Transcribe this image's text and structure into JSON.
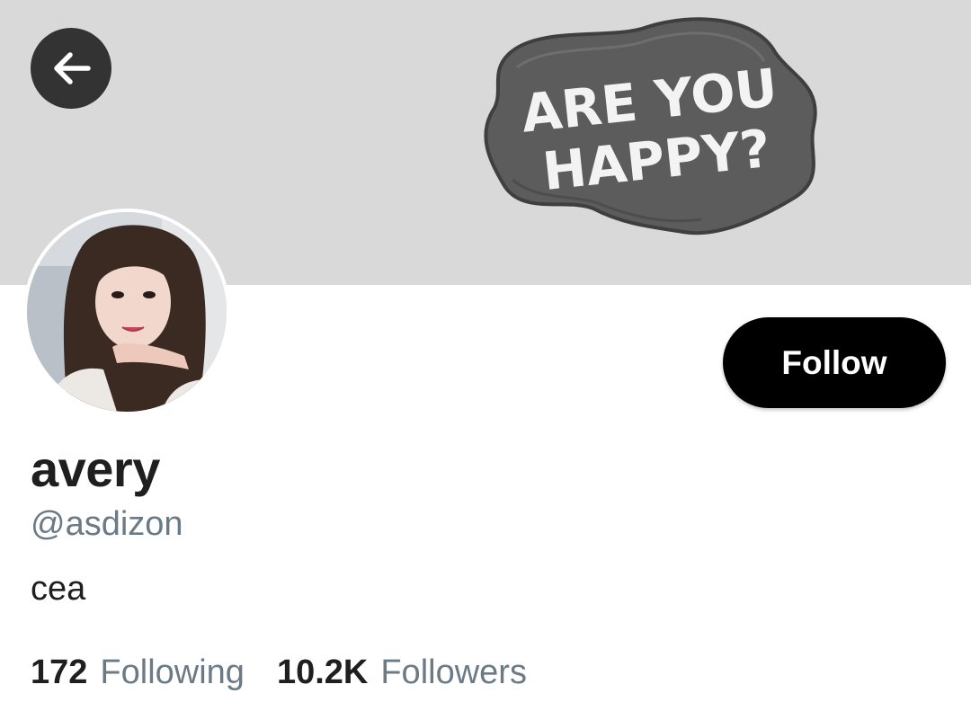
{
  "banner": {
    "image_text_line1": "ARE YOU",
    "image_text_line2": "HAPPY?"
  },
  "profile": {
    "display_name": "avery",
    "handle": "@asdizon",
    "bio": "cea",
    "follow_label": "Follow"
  },
  "stats": {
    "following_count": "172",
    "following_label": "Following",
    "followers_count": "10.2K",
    "followers_label": "Followers"
  },
  "icons": {
    "back": "arrow-left-icon"
  },
  "colors": {
    "banner_bg": "#d9d9d9",
    "back_button_bg": "#333333",
    "follow_bg": "#000000",
    "secondary_text": "#6b7a87",
    "primary_text": "#1f1f1f"
  }
}
